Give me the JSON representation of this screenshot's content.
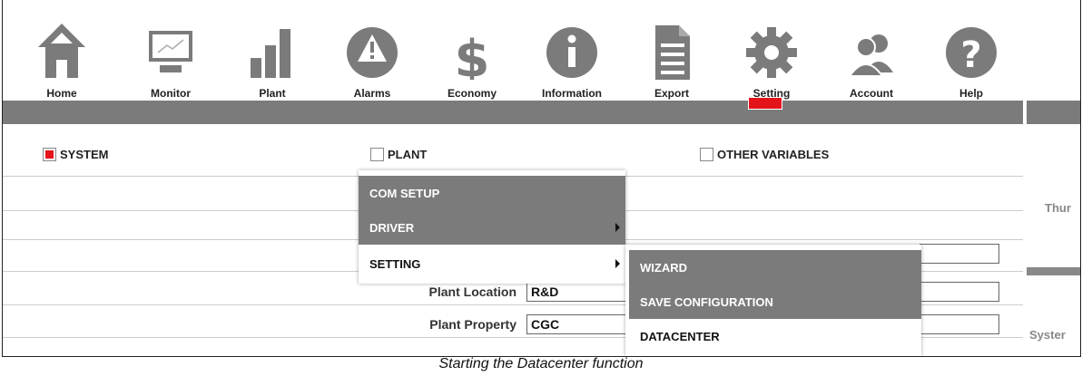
{
  "nav": {
    "items": [
      {
        "label": "Home",
        "icon": "home-icon"
      },
      {
        "label": "Monitor",
        "icon": "monitor-icon"
      },
      {
        "label": "Plant",
        "icon": "bar-chart-icon"
      },
      {
        "label": "Alarms",
        "icon": "warning-icon"
      },
      {
        "label": "Economy",
        "icon": "dollar-icon"
      },
      {
        "label": "Information",
        "icon": "info-icon"
      },
      {
        "label": "Export",
        "icon": "document-icon"
      },
      {
        "label": "Setting",
        "icon": "gear-icon"
      },
      {
        "label": "Account",
        "icon": "users-icon"
      },
      {
        "label": "Help",
        "icon": "help-icon"
      }
    ],
    "active": "Setting"
  },
  "tabs": {
    "system": "SYSTEM",
    "plant": "PLANT",
    "other": "OTHER VARIABLES"
  },
  "menu": {
    "com_setup": "COM SETUP",
    "driver": "DRIVER",
    "setting": "SETTING"
  },
  "submenu": {
    "wizard": "WIZARD",
    "save_configuration": "SAVE CONFIGURATION",
    "datacenter": "DATACENTER"
  },
  "form": {
    "plant_location_label": "Plant Location",
    "plant_location_value": "R&D",
    "plant_property_label": "Plant Property",
    "plant_property_value": "CGC"
  },
  "right_pane": {
    "text1": "Thur",
    "text2": "Syster"
  },
  "caption": "Starting the Datacenter function",
  "colors": {
    "accent": "#e4141b",
    "bar": "#7b7b7b",
    "icon": "#7b7b7b"
  }
}
